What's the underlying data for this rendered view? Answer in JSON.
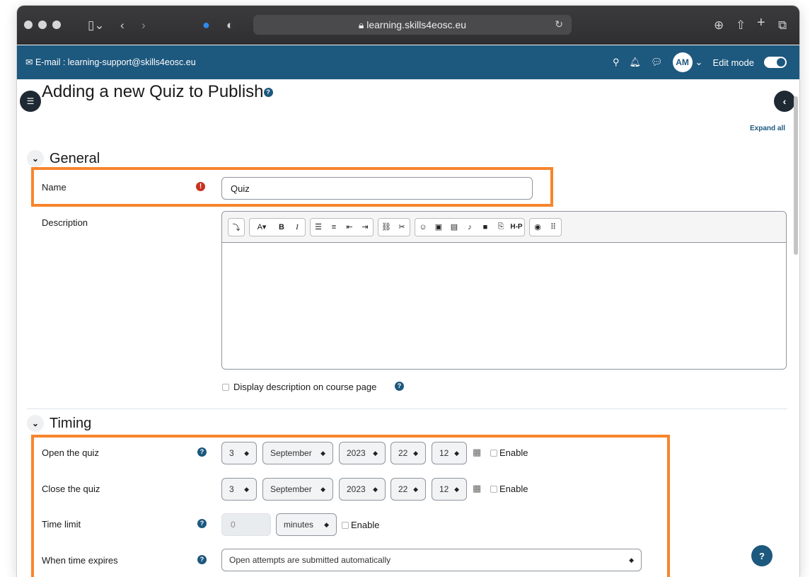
{
  "browser": {
    "url": "learning.skills4eosc.eu",
    "lock_icon": "lock-icon",
    "reload_icon": "reload-icon"
  },
  "navbar": {
    "email": "E-mail : learning-support@skills4eosc.eu",
    "avatar_initials": "AM",
    "edit_mode_label": "Edit mode",
    "brand_color": "#1d587e"
  },
  "page": {
    "title": "Adding a new Quiz to Publish",
    "expand_all": "Expand all"
  },
  "general": {
    "heading": "General",
    "name_label": "Name",
    "name_value": "Quiz",
    "description_label": "Description",
    "display_description": "Display description on course page"
  },
  "timing": {
    "heading": "Timing",
    "open_label": "Open the quiz",
    "close_label": "Close the quiz",
    "open": {
      "day": "3",
      "month": "September",
      "year": "2023",
      "hour": "22",
      "minute": "12",
      "enable": "Enable"
    },
    "close": {
      "day": "3",
      "month": "September",
      "year": "2023",
      "hour": "22",
      "minute": "12",
      "enable": "Enable"
    },
    "time_limit_label": "Time limit",
    "time_limit_value": "0",
    "time_limit_unit": "minutes",
    "time_limit_enable": "Enable",
    "expires_label": "When time expires",
    "expires_value": "Open attempts are submitted automatically"
  },
  "editor_toolbar": [
    "collapse",
    "text-style",
    "bold",
    "italic",
    "unordered-list",
    "ordered-list",
    "outdent",
    "indent",
    "link",
    "unlink",
    "emoji",
    "image",
    "media",
    "record-audio",
    "record-video",
    "manage-files",
    "h5p",
    "accessibility-checker",
    "screenreader-helper"
  ],
  "highlight_color": "#f7852c"
}
